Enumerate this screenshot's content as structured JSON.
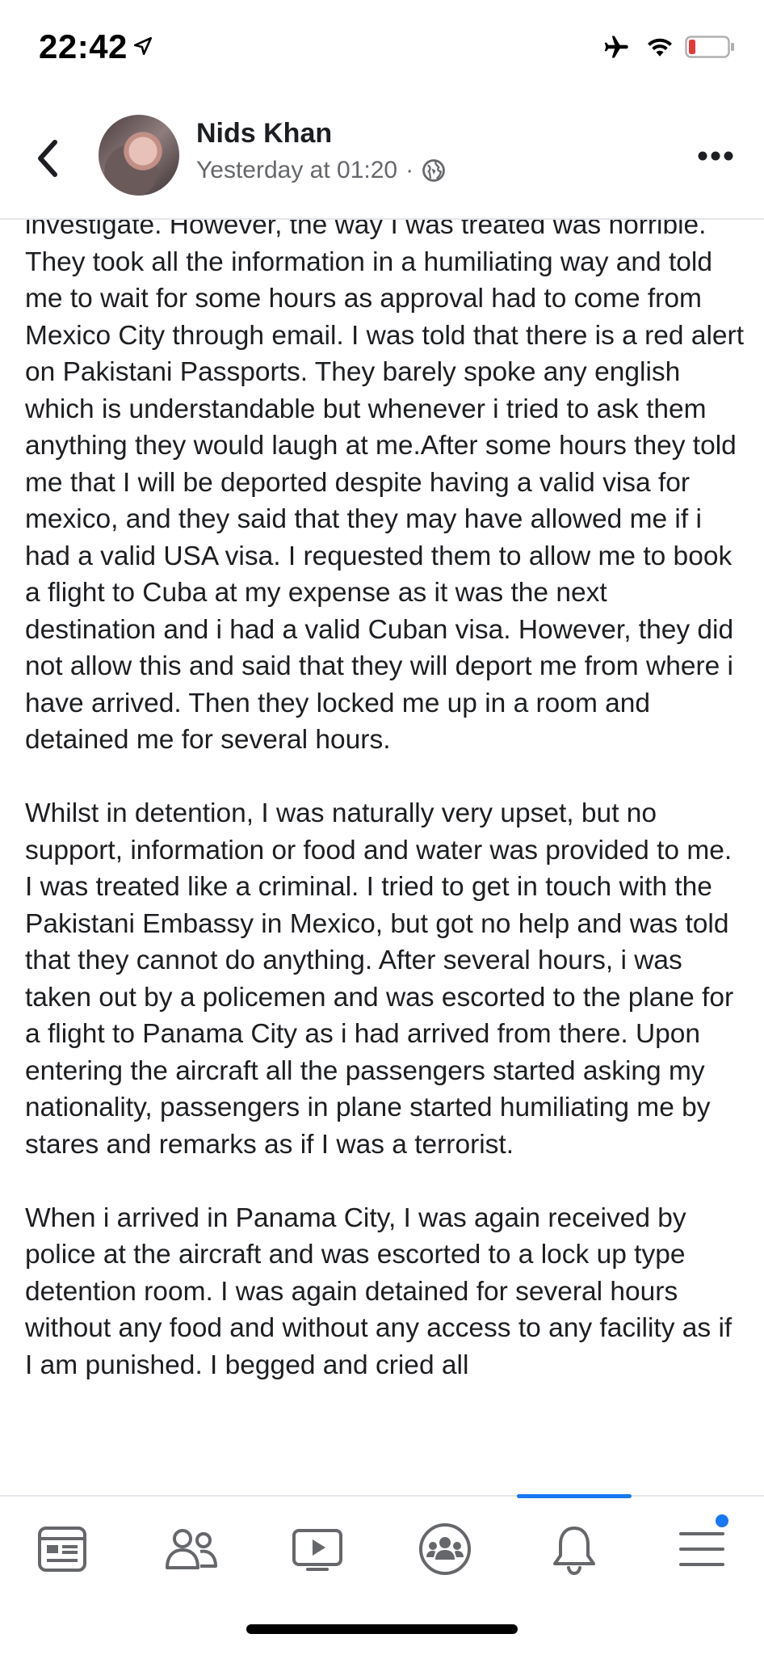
{
  "status_bar": {
    "time": "22:42",
    "icons": [
      "location-arrow-icon",
      "airplane-icon",
      "wifi-icon",
      "battery-low-icon"
    ],
    "battery_color": "#e53935"
  },
  "header": {
    "back_icon": "chevron-left-icon",
    "author": "Nids Khan",
    "timestamp": "Yesterday at 01:20",
    "separator": "·",
    "privacy_icon": "globe-icon",
    "more_icon": "more-horizontal-icon"
  },
  "post": {
    "paragraphs": [
      "investigate. However, the way I was treated was horrible. They took all the information in a humiliating way and told me to wait for some hours as approval had to come from Mexico City through email. I was told that there is a red alert on Pakistani Passports. They barely spoke any english which is understandable but whenever i tried to ask them anything they would laugh at me.After some hours they told me that I will be deported despite having a valid visa for mexico, and they said that they may have allowed me if i had a valid USA visa. I requested them to allow me to book a flight to Cuba at my expense as it was the next destination and i had a valid Cuban visa. However, they did not allow this and said that they will deport me from where i have arrived. Then they locked me up in a room and detained me for several hours.",
      "Whilst in detention, I was naturally very upset, but no support, information or food and water was provided to me. I was treated like a criminal. I tried to get in touch with the Pakistani Embassy in Mexico, but got no help and was told that they cannot do anything. After several hours, i was taken out by a policemen and was escorted to the plane for a flight to Panama City as i had arrived from there. Upon entering the aircraft all the passengers started asking my nationality, passengers in plane started humiliating me by stares and remarks as if I was a terrorist.",
      "When i arrived in Panama City, I was again received by police at the aircraft and was escorted to a lock up type detention room. I was again detained for several hours without any food and without any access to any facility as if I am punished. I begged and cried all"
    ]
  },
  "tab_bar": {
    "tabs": [
      "news-feed-icon",
      "friends-icon",
      "watch-icon",
      "groups-icon",
      "notifications-icon",
      "menu-icon"
    ],
    "accent": "#1877f2"
  }
}
